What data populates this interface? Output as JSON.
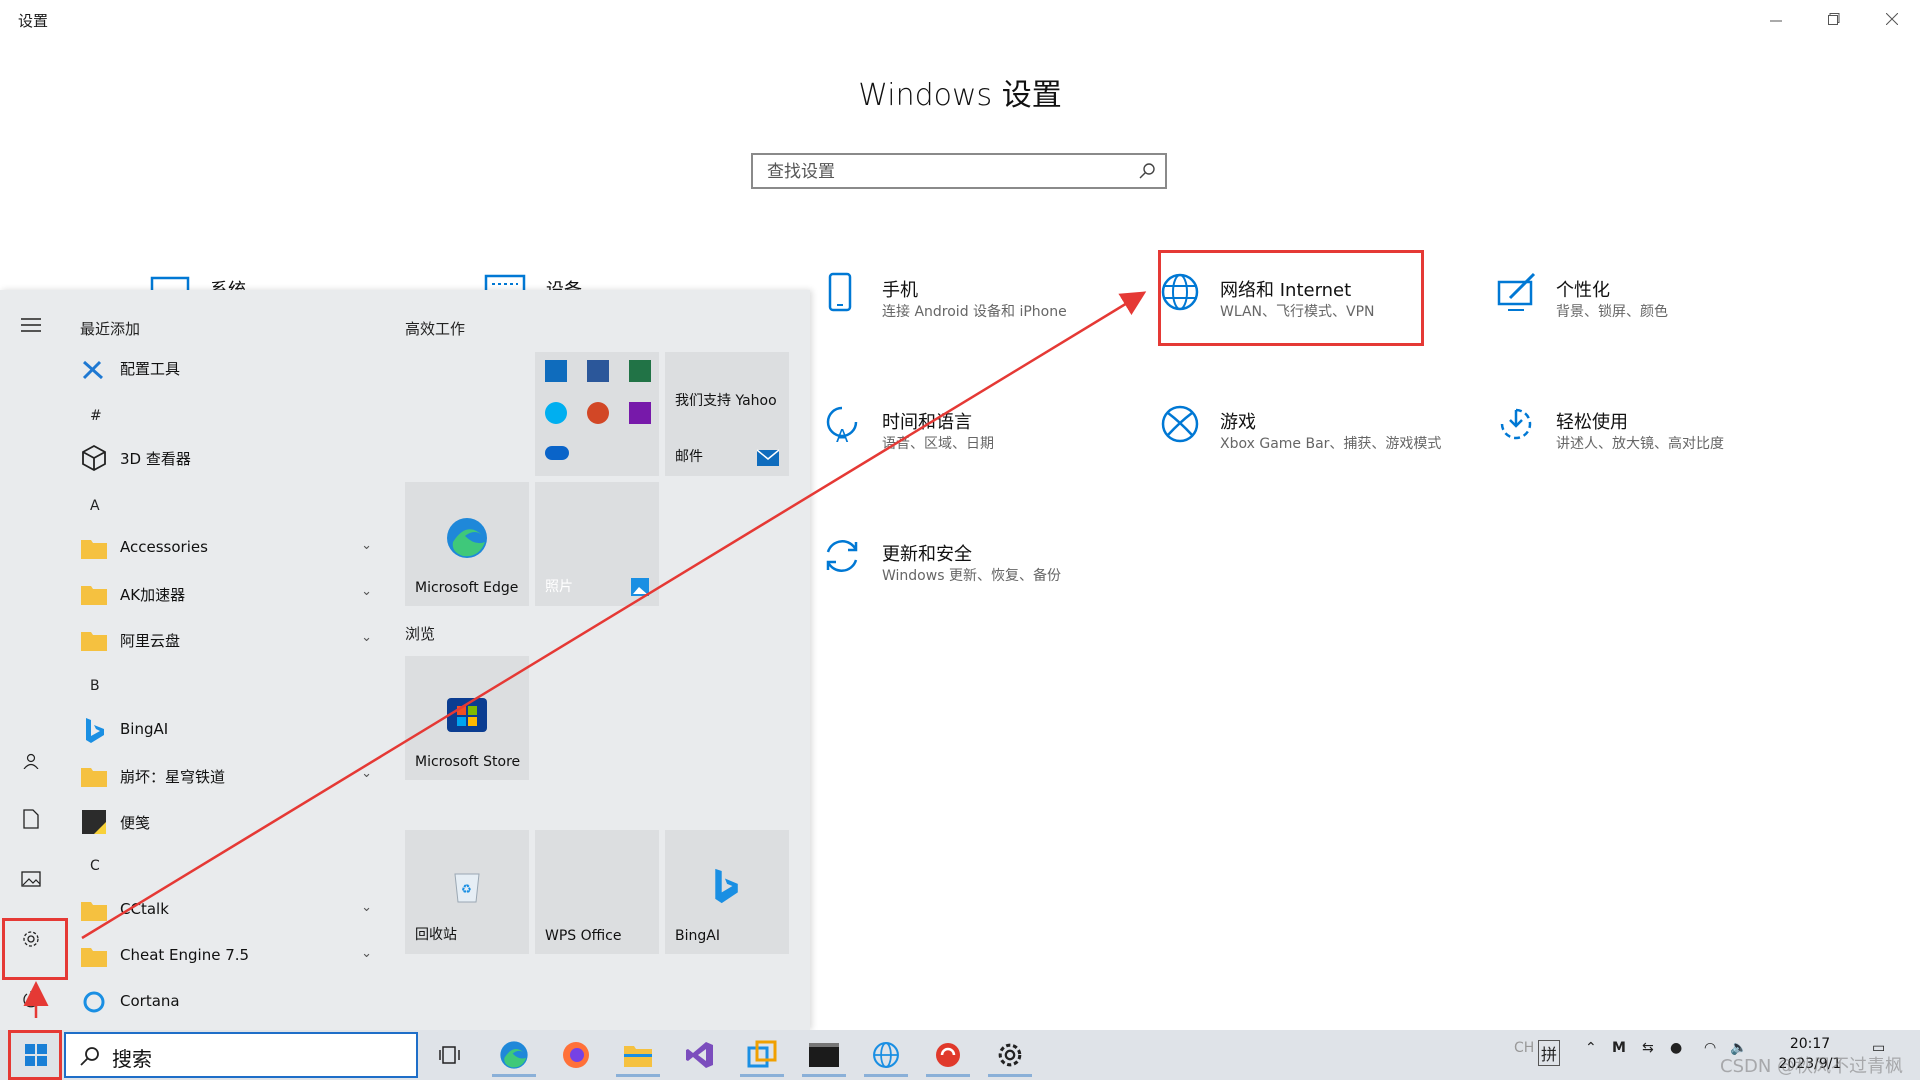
{
  "window": {
    "title": "设置",
    "min_icon": "minimize-icon",
    "max_icon": "maximize-icon",
    "close_icon": "close-icon",
    "heading": "Windows 设置",
    "search_placeholder": "查找设置"
  },
  "settings_tiles": {
    "system": {
      "title": "系统",
      "icon": "monitor-icon"
    },
    "devices": {
      "title": "设备",
      "icon": "keyboard-icon"
    },
    "phone": {
      "title": "手机",
      "desc": "连接 Android 设备和 iPhone",
      "icon": "phone-icon"
    },
    "network": {
      "title": "网络和 Internet",
      "desc": "WLAN、飞行模式、VPN",
      "icon": "globe-icon"
    },
    "personalization": {
      "title": "个性化",
      "desc": "背景、锁屏、颜色",
      "icon": "paint-icon"
    },
    "time": {
      "title": "时间和语言",
      "desc": "语音、区域、日期",
      "icon": "time-language-icon"
    },
    "gaming": {
      "title": "游戏",
      "desc": "Xbox Game Bar、捕获、游戏模式",
      "icon": "xbox-icon"
    },
    "ease": {
      "title": "轻松使用",
      "desc": "讲述人、放大镜、高对比度",
      "icon": "ease-of-access-icon"
    },
    "update": {
      "title": "更新和安全",
      "desc": "Windows 更新、恢复、备份",
      "icon": "refresh-icon"
    }
  },
  "start_menu": {
    "recent_label": "最近添加",
    "apps": [
      {
        "label": "配置工具",
        "icon": "tools-icon"
      },
      {
        "label": "3D 查看器",
        "icon": "cube-icon"
      },
      {
        "label": "Accessories",
        "icon": "folder-icon"
      },
      {
        "label": "AK加速器",
        "icon": "folder-icon"
      },
      {
        "label": "阿里云盘",
        "icon": "folder-icon"
      },
      {
        "label": "BingAI",
        "icon": "bing-icon"
      },
      {
        "label": "崩坏：星穹铁道",
        "icon": "folder-icon"
      },
      {
        "label": "便笺",
        "icon": "sticky-notes-icon"
      },
      {
        "label": "CCtalk",
        "icon": "folder-icon"
      },
      {
        "label": "Cheat Engine 7.5",
        "icon": "folder-icon"
      },
      {
        "label": "Cortana",
        "icon": "cortana-icon"
      }
    ],
    "sections": [
      "#",
      "A",
      "B",
      "C"
    ],
    "group_work": "高效工作",
    "group_browse": "浏览",
    "yahoo_text": "我们支持 Yahoo",
    "mail_label": "邮件",
    "edge_label": "Microsoft Edge",
    "photos_label": "照片",
    "store_label": "Microsoft Store",
    "recycle_label": "回收站",
    "wps_label": "WPS Office",
    "bingai_tile_label": "BingAI"
  },
  "taskbar": {
    "search_text": "搜索",
    "ime": "拼",
    "ime_prefix": "CH",
    "time": "20:17",
    "date": "2023/9/1"
  },
  "watermark": "CSDN @秋风不过青枫",
  "colors": {
    "accent": "#0078d4",
    "highlight": "#e53935",
    "taskbar": "#dfe3e8",
    "start_bg": "#e9ebed"
  }
}
